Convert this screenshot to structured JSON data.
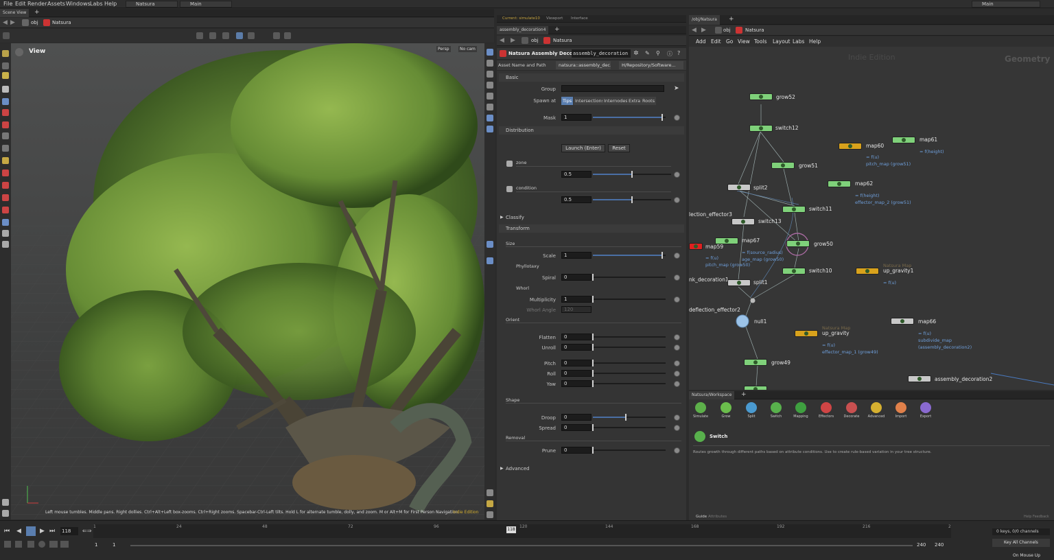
{
  "menubar": {
    "items": [
      "File",
      "Edit",
      "Render",
      "Assets",
      "Windows",
      "Labs",
      "Help"
    ],
    "desktop": "Natsura",
    "context": "Main",
    "right_context": "Main"
  },
  "left_pane": {
    "tab": "Scene View",
    "path_obj": "obj",
    "path_asset": "Natsura",
    "view_label": "View",
    "persp_btn": "Persp",
    "cam_btn": "No cam",
    "status_text": "Left mouse tumbles. Middle pans. Right dollies. Ctrl+Alt+Left box-zooms. Ctrl+Right zooms. Spacebar-Ctrl-Left tilts. Hold L for alternate tumble, dolly, and zoom. M or Alt+M for First Person Navigation.",
    "edition": "Indie Edition"
  },
  "middle_pane": {
    "top_tabs": [
      "Current: simulate10",
      "Viewport",
      "Interface"
    ],
    "tab": "assembly_decoration4",
    "path_obj": "obj",
    "path_asset": "Natsura",
    "node_type": "Natsura Assembly Decorat...",
    "node_name": "assembly_decoration",
    "asset_label": "Asset Name and Path",
    "asset_name": "natsura::assembly_dec...",
    "asset_path": "H/Repository/Software...",
    "sections": {
      "basic": "Basic",
      "distribution": "Distribution",
      "classify": "Classify",
      "transform": "Transform",
      "advanced": "Advanced"
    },
    "group_label": "Group",
    "spawn_label": "Spawn at",
    "spawn_options": [
      "Tips",
      "Intersections",
      "Internodes",
      "Extra",
      "Roots"
    ],
    "mask_label": "Mask",
    "mask_value": "1",
    "launch_btn": "Launch (Enter)",
    "reset_btn": "Reset",
    "zone_label": "zone",
    "zone_value": "0.5",
    "condition_label": "condition",
    "condition_value": "0.5",
    "size_label": "Size",
    "scale_label": "Scale",
    "scale_value": "1",
    "phyllotaxy_label": "Phyllotaxy",
    "spiral_label": "Spiral",
    "spiral_value": "0",
    "whorl_label": "Whorl",
    "multiplicity_label": "Multiplicity",
    "multiplicity_value": "1",
    "whorl_angle_label": "Whorl Angle",
    "whorl_angle_value": "120",
    "orient_label": "Orient",
    "flatten_label": "Flatten",
    "flatten_value": "0",
    "unroll_label": "Unroll",
    "unroll_value": "0",
    "pitch_label": "Pitch",
    "pitch_value": "0",
    "roll_label": "Roll",
    "roll_value": "0",
    "yaw_label": "Yaw",
    "yaw_value": "0",
    "shape_label": "Shape",
    "droop_label": "Droop",
    "droop_value": "0",
    "spread_label": "Spread",
    "spread_value": "0",
    "removal_label": "Removal",
    "prune_label": "Prune",
    "prune_value": "0",
    "levels": {
      "mask": 0.95,
      "zone": 0.5,
      "condition": 0.5,
      "scale": 0.95,
      "droop": 0.45
    }
  },
  "right_pane": {
    "tab": "/obj/Natsura",
    "path_obj": "obj",
    "path_asset": "Natsura",
    "menu": [
      "Add",
      "Edit",
      "Go",
      "View",
      "Tools",
      "Layout",
      "Labs",
      "Help"
    ],
    "watermark": "Indie Edition",
    "context_label": "Geometry",
    "nodes": {
      "grow52": "grow52",
      "switch12": "switch12",
      "grow51": "grow51",
      "map60": "map60",
      "map61": "map61",
      "split2": "split2",
      "map62": "map62",
      "switch11": "switch11",
      "deflection_effector3": "lection_effector3",
      "switch13": "switch13",
      "map59": "map59",
      "map67": "map67",
      "grow50": "grow50",
      "switch10": "switch10",
      "up_gravity1": "up_gravity1",
      "assembly_decoration1": "nk_decoration1",
      "split1": "split1",
      "deflection_effector2": "deflection_effector2",
      "null1": "null1",
      "up_gravity": "up_gravity",
      "map66": "map66",
      "grow49": "grow49",
      "assembly_decoration2": "assembly_decoration2"
    },
    "subs": {
      "map61": "= f(height)",
      "map60a": "= f(u)",
      "map60b": "pitch_map (grow51)",
      "map62a": "= f(height)",
      "map62b": "effector_map_2 (grow51)",
      "map59a": "= f(u)",
      "map59b": "pitch_map (grow50)",
      "map67a": "= f(source_radius)",
      "map67b": "age_map (grow50)",
      "up_gravity1_type": "Natsura Map",
      "up_gravity1_a": "= f(u)",
      "up_gravity_type": "Natsura Map",
      "up_gravity_a": "= f(u)",
      "up_gravity_b": "effector_map_1 (grow49)",
      "map66a": "= f(u)",
      "map66b": "subdivide_map",
      "map66c": "(assembly_decoration2)"
    }
  },
  "shelf": {
    "tab": "Natsura/Workspace",
    "tools": [
      "Simulate",
      "Grow",
      "Split",
      "Switch",
      "Mapping",
      "Effectors",
      "Decorate",
      "Advanced",
      "Import",
      "Export"
    ],
    "help_title": "Switch",
    "help_text": "Routes growth through different paths based on attribute conditions. Use to create rule-based variation in your tree structure.",
    "footer_tab": "Guide",
    "footer_tab2": "Attributes",
    "footer_right": "Help Feedback"
  },
  "timeline": {
    "frame": "118",
    "frame_marker": "118",
    "ticks": [
      "1",
      "24",
      "48",
      "72",
      "96",
      "120",
      "144",
      "168",
      "192",
      "216",
      "2"
    ],
    "start": "1",
    "start2": "1",
    "end": "240",
    "end2": "240",
    "keys_info": "0 keys, 0/0 channels",
    "key_all": "Key All Channels",
    "on_mouse_up": "On Mouse Up"
  },
  "colors": {
    "node_green": "#7fd17a",
    "node_gray": "#c8c8c8",
    "node_yellow": "#d8a21c",
    "node_red": "#e02020",
    "link_blue": "#6fa0dd"
  }
}
